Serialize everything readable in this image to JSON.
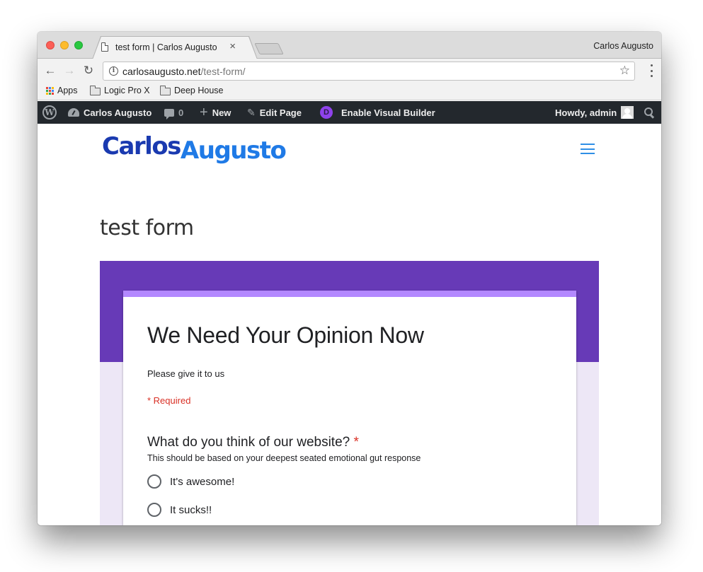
{
  "browser": {
    "tab_title": "test form | Carlos Augusto",
    "profile_name": "Carlos Augusto",
    "url_host": "carlosaugusto.net",
    "url_path": "/test-form/",
    "bookmarks": [
      {
        "label": "Apps",
        "icon": "apps-grid-icon"
      },
      {
        "label": "Logic Pro X",
        "icon": "folder-icon"
      },
      {
        "label": "Deep House",
        "icon": "folder-icon"
      }
    ],
    "icons": {
      "close": "×",
      "back": "←",
      "forward": "→",
      "reload": "↻",
      "info": "i",
      "star": "☆"
    },
    "apps_colors": [
      "#ea4335",
      "#4285f4",
      "#fbbc05",
      "#34a853",
      "#ea4335",
      "#4285f4",
      "#fbbc05",
      "#34a853",
      "#ea4335"
    ]
  },
  "adminbar": {
    "site_name": "Carlos Augusto",
    "comments_count": "0",
    "new_label": "New",
    "edit_label": "Edit Page",
    "builder_label": "Enable Visual Builder",
    "builder_icon_letter": "D",
    "greeting": "Howdy, admin",
    "wp_logo_letter": "W",
    "plus": "+",
    "pencil": "✎"
  },
  "site": {
    "logo_first": "Carlos",
    "logo_last": "Augusto",
    "page_title": "test form"
  },
  "form": {
    "title": "We Need Your Opinion Now",
    "description": "Please give it to us",
    "required_note": "* Required",
    "question": {
      "title": "What do you think of our website?",
      "required_mark": "*",
      "help_text": "This should be based on your deepest seated emotional gut response",
      "options": [
        "It's awesome!",
        "It sucks!!"
      ]
    },
    "colors": {
      "header": "#673ab7",
      "accent": "#b388ff",
      "background": "#ede7f6",
      "required": "#d93025"
    }
  }
}
